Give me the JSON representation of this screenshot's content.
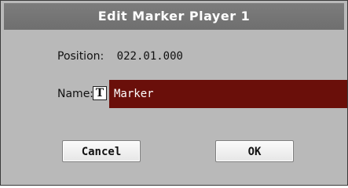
{
  "dialog": {
    "title": "Edit Marker Player 1"
  },
  "position": {
    "label": "Position:",
    "value": "022.01.000"
  },
  "name": {
    "label": "Name:",
    "text_icon": "T",
    "value": "Marker"
  },
  "buttons": {
    "cancel": "Cancel",
    "ok": "OK"
  },
  "colors": {
    "title_bar": "#757575",
    "dialog_background": "#b9b9b9",
    "name_field": "#6a0f0a",
    "button_face": "#f2f2f2"
  },
  "icons": {
    "text_edit": "text-edit-icon"
  }
}
